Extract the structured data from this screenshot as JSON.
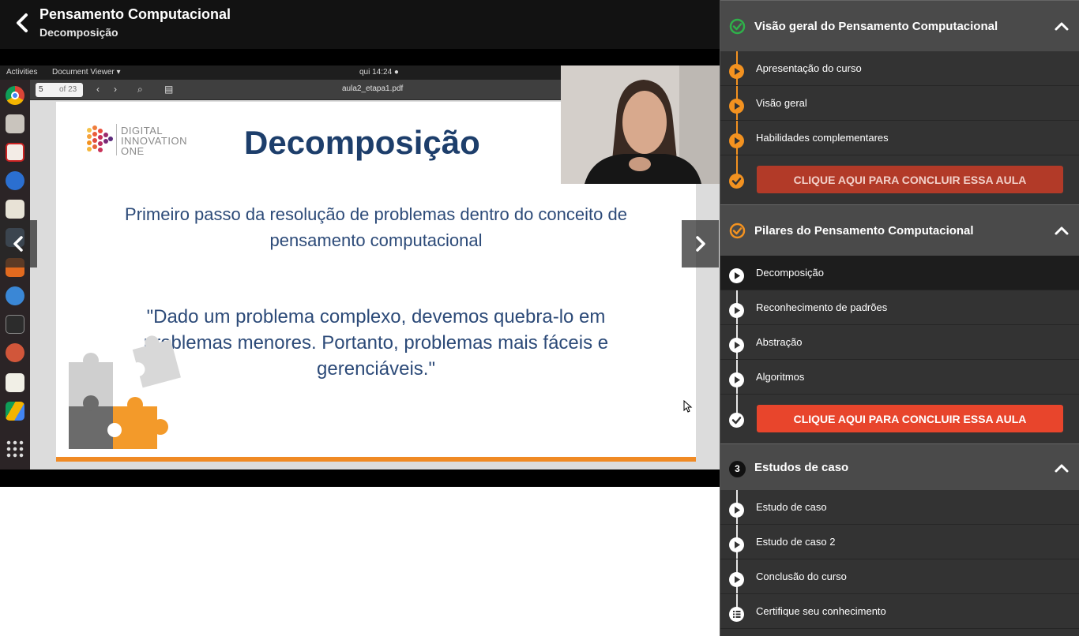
{
  "header": {
    "course_title": "Pensamento Computacional",
    "lesson_subtitle": "Decomposição"
  },
  "video": {
    "desktop": {
      "activities": "Activities",
      "app_menu": "Document Viewer ▾",
      "clock": "qui 14:24 ●",
      "page_current": "5",
      "page_total": "of 23",
      "document_name": "aula2_etapa1.pdf"
    },
    "slide": {
      "logo_text": [
        "DIGITAL",
        "INNOVATION",
        "ONE"
      ],
      "title": "Decomposição",
      "subtitle": "Primeiro passo da resolução de problemas dentro do conceito de pensamento computacional",
      "quote": "\"Dado um problema complexo, devemos quebra-lo em problemas menores. Portanto, problemas mais fáceis e gerenciáveis.\""
    }
  },
  "sidebar": {
    "modules": [
      {
        "title": "Visão geral do Pensamento Computacional",
        "status": "completed",
        "lessons": [
          "Apresentação do curso",
          "Visão geral",
          "Habilidades complementares"
        ],
        "conclude_label": "CLIQUE AQUI PARA CONCLUIR ESSA AULA"
      },
      {
        "title": "Pilares do Pensamento Computacional",
        "status": "in-progress",
        "lessons": [
          "Decomposição",
          "Reconhecimento de padrões",
          "Abstração",
          "Algoritmos"
        ],
        "conclude_label": "CLIQUE AQUI PARA CONCLUIR ESSA AULA"
      },
      {
        "title": "Estudos de caso",
        "number": "3",
        "lessons": [
          "Estudo de caso",
          "Estudo de caso 2",
          "Conclusão do curso",
          "Certifique seu conhecimento"
        ]
      }
    ]
  },
  "colors": {
    "accent_orange": "#f39220",
    "success_green": "#2fb14a",
    "conclude_done": "#b23a28",
    "conclude_active": "#e8452c",
    "slide_title_blue": "#1d3e6b"
  },
  "icons": {
    "back": "chevron-left-icon",
    "module_caret": "chevron-up-icon",
    "lesson": "play-circle-icon",
    "done": "check-circle-icon",
    "certificate": "list-circle-icon"
  }
}
